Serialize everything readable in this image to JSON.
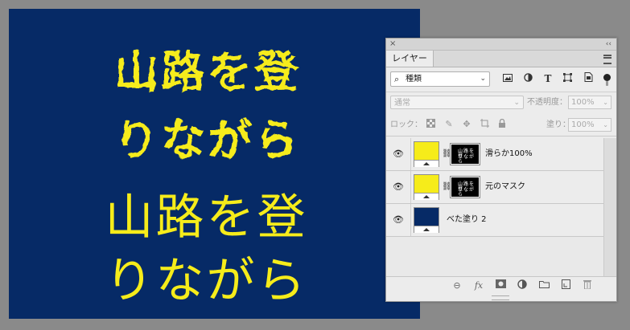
{
  "canvas": {
    "text_rough_line1": "山路を登",
    "text_rough_line2": "りながら",
    "text_clean_line1": "山路を登",
    "text_clean_line2": "りながら",
    "background_color": "#062a66",
    "text_color": "#f6ec1a"
  },
  "panel": {
    "close_glyph": "×",
    "collapse_glyph": "‹‹",
    "tab_label": "レイヤー",
    "filter_kind_label": "種類",
    "blend_mode": "通常",
    "opacity_label": "不透明度：",
    "opacity_value": "100%",
    "lock_label": "ロック：",
    "fill_label": "塗り：",
    "fill_value": "100%",
    "layers": [
      {
        "name": "滑らか100%",
        "thumb_color": "#f6ec1a",
        "has_mask": true,
        "mask_text1": "山路を登",
        "mask_text2": "りながら"
      },
      {
        "name": "元のマスク",
        "thumb_color": "#f6ec1a",
        "has_mask": true,
        "mask_text1": "山路を登",
        "mask_text2": "りながら"
      },
      {
        "name": "べた塗り 2",
        "thumb_color": "#062a66",
        "has_mask": false
      }
    ],
    "filter_icons": [
      "image-filter-icon",
      "adjustment-filter-icon",
      "type-filter-icon",
      "shape-filter-icon",
      "smart-object-filter-icon"
    ],
    "bottom_icons": [
      "link-layers-icon",
      "fx-icon",
      "add-mask-icon",
      "new-adjustment-icon",
      "new-group-icon",
      "new-layer-icon",
      "delete-icon"
    ]
  }
}
